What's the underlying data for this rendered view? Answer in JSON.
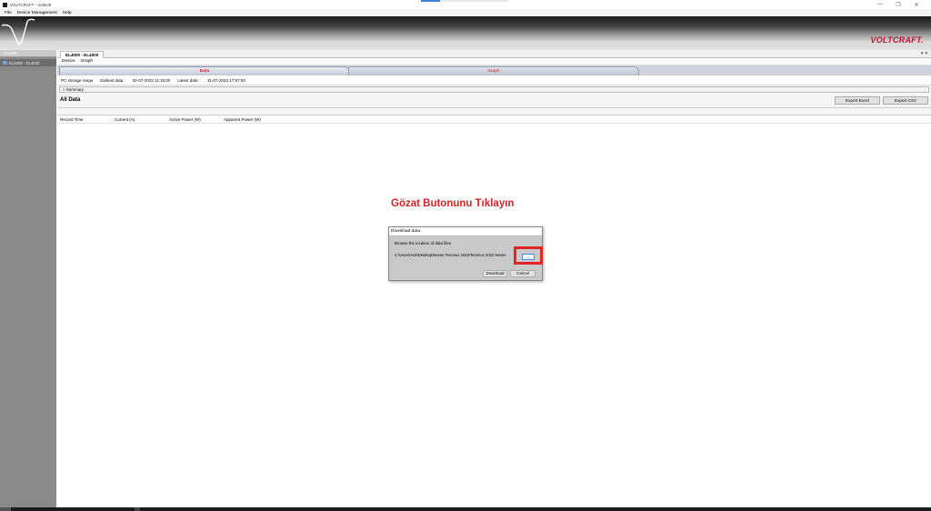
{
  "window": {
    "title": "VOLTCRAFT - Voltsoft",
    "controls": [
      "—",
      "❐",
      "✕"
    ]
  },
  "menubar": {
    "items": [
      "File",
      "Device Management",
      "Help"
    ]
  },
  "banner": {
    "brand": "VOLTCRAFT."
  },
  "sidebar": {
    "header": "EL4000",
    "items": [
      {
        "label": "EL4000 - EL4000"
      }
    ]
  },
  "document_tab": {
    "label": "EL4000 - EL4000",
    "pin": "▾ ✕"
  },
  "subnav": {
    "items": [
      "Device",
      "Graph"
    ]
  },
  "view_tabs": {
    "data": "Data",
    "graph": "Graph"
  },
  "info": {
    "storage": "PC storage range",
    "earliest_label": "Earliest data :",
    "earliest_value": "02-07-2022 11:15:00",
    "latest_label": "Latest data :",
    "latest_value": "31-07-2022 17:57:00"
  },
  "summary": {
    "label": "» Summary"
  },
  "all_data": {
    "heading": "All Data",
    "export_excel": "Export Excel",
    "export_csv": "Export CSV",
    "columns": [
      "Record Time",
      "Current (A)",
      "Active Power (W)",
      "Apparent Power (W)"
    ]
  },
  "instruction": "Gözat Butonunu Tıklayın",
  "dialog": {
    "title": "Download data",
    "prompt": "Browse the location of data files",
    "path": "C:\\Users\\Adv\\Desktop\\Nesne Temmuz 2022\\Temmuz 2022 Nesne",
    "browse": "...",
    "download": "Download",
    "cancel": "Cancel"
  },
  "colors": {
    "brand": "#c8102e",
    "highlight": "#e0242b",
    "tab_text": "#d42020"
  }
}
